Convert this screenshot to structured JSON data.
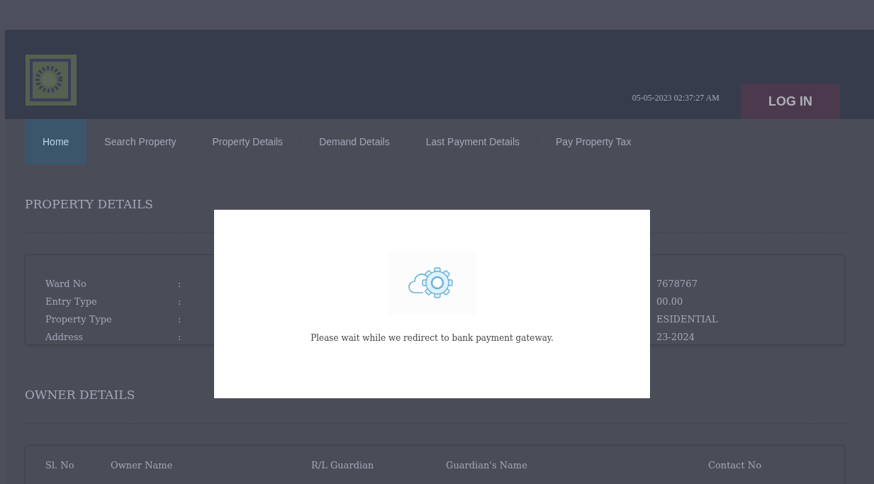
{
  "header": {
    "datetime": "05-05-2023 02:37:27 AM",
    "login_button": "LOG IN"
  },
  "nav": {
    "tabs": [
      {
        "label": "Home",
        "selected": true
      },
      {
        "label": "Search Property",
        "selected": false
      },
      {
        "label": "Property Details",
        "selected": false
      },
      {
        "label": "Demand Details",
        "selected": false
      },
      {
        "label": "Last Payment Details",
        "selected": false
      },
      {
        "label": "Pay Property Tax",
        "selected": false
      }
    ]
  },
  "property_details": {
    "title": "PROPERTY DETAILS",
    "rows": [
      {
        "label": "Ward No",
        "colon": ":"
      },
      {
        "label": "Entry Type",
        "colon": ":"
      },
      {
        "label": "Property Type",
        "colon": ":"
      },
      {
        "label": "Address",
        "colon": ":"
      }
    ],
    "right_values": [
      "7678767",
      "00.00",
      "ESIDENTIAL",
      "23-2024"
    ]
  },
  "owner_details": {
    "title": "OWNER DETAILS",
    "columns": [
      "Sl. No",
      "Owner Name",
      "R/L Guardian",
      "Guardian's Name",
      "Contact No"
    ]
  },
  "modal": {
    "message": "Please wait while we redirect to bank payment gateway."
  }
}
